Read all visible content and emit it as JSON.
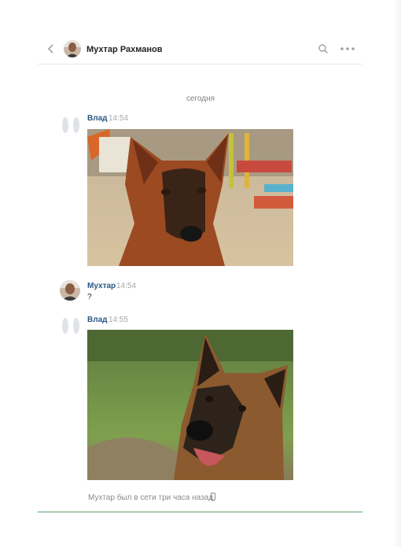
{
  "header": {
    "contact_name": "Мухтар Рахманов",
    "icons": [
      "chevron-left-icon",
      "avatar",
      "search-icon",
      "more-dots-icon"
    ]
  },
  "date_divider": "сегодня",
  "messages": [
    {
      "author": "Влад",
      "time": "14:54",
      "type": "photo",
      "photo": "german-shepherd-dog-on-playground"
    },
    {
      "author": "Мухтар",
      "time": "14:54",
      "type": "text",
      "text": "?"
    },
    {
      "author": "Влад",
      "time": "14:55",
      "type": "photo",
      "photo": "german-shepherd-dog-in-grass"
    }
  ],
  "status": {
    "text": "Мухтар был в сети три часа назад",
    "icon": "mobile-phone-icon"
  },
  "colors": {
    "name_blue": "#2a5885",
    "divider": "#e7e8ec",
    "composer_green": "#5aa46b",
    "muted": "#828282"
  }
}
